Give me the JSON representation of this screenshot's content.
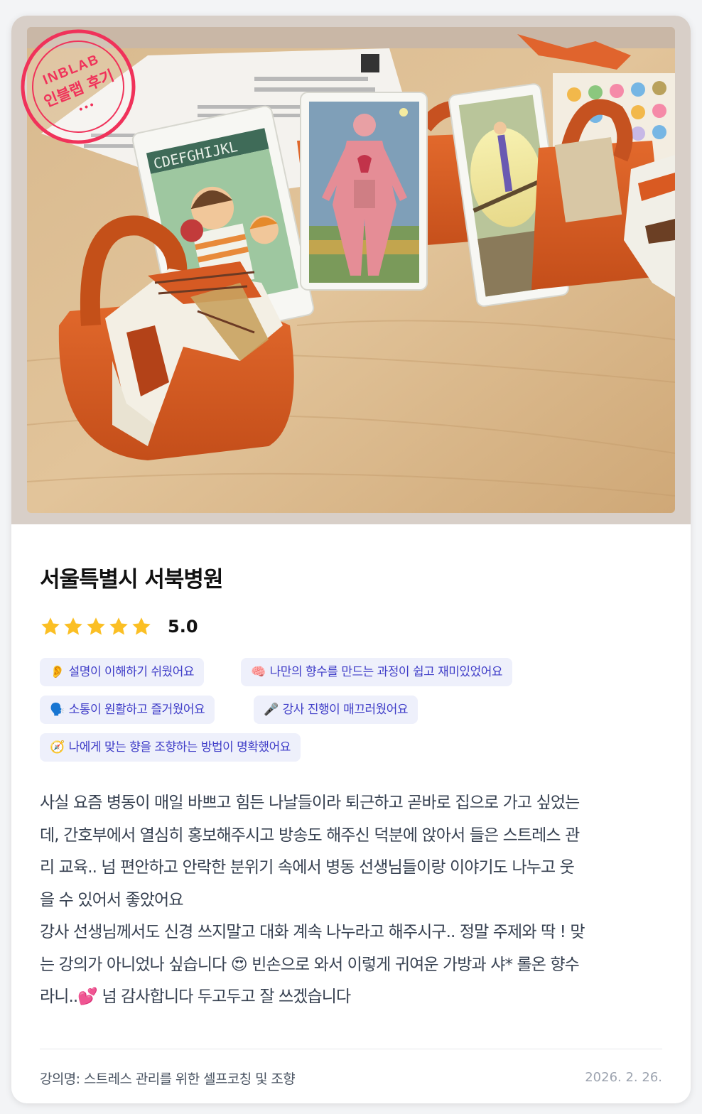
{
  "stamp": {
    "line1": "INBLAB",
    "line2": "인블랩 후기",
    "dots": "•••"
  },
  "review_card": {
    "title": "서울특별시 서북병원",
    "rating": {
      "stars": 5,
      "score": "5.0",
      "star_color": "#fbbf24"
    },
    "tags": [
      {
        "icon": "ear-icon",
        "emoji": "👂",
        "label": "설명이 이해하기 쉬웠어요"
      },
      {
        "icon": "brain-icon",
        "emoji": "🧠",
        "label": "나만의 향수를 만드는 과정이 쉽고 재미있었어요"
      },
      {
        "icon": "speaking-icon",
        "emoji": "🗣️",
        "label": "소통이 원활하고 즐거웠어요"
      },
      {
        "icon": "microphone-icon",
        "emoji": "🎤",
        "label": "강사 진행이 매끄러웠어요"
      },
      {
        "icon": "compass-icon",
        "emoji": "🧭",
        "label": "나에게 맞는 향을 조향하는 방법이 명확했어요"
      }
    ],
    "review_lines": [
      "사실 요즘 병동이 매일 바쁘고 힘든 나날들이라 퇴근하고 곧바로 집으로 가고 싶었는",
      "데, 간호부에서 열심히 홍보해주시고 방송도 해주신 덕분에 앉아서 들은 스트레스 관",
      "리 교육.. 넘 편안하고 안락한 분위기 속에서 병동 선생님들이랑 이야기도 나누고 웃",
      "을 수 있어서 좋았어요",
      "강사 선생님께서도 신경 쓰지말고 대화 계속 나누라고 해주시구.. 정말 주제와 딱 ! 맞",
      "는 강의가 아니었나 싶습니다 😍 빈손으로 와서 이렇게 귀여운 가방과 샤* 롤온 향수",
      "라니..💕 넘 감사합니다 두고두고 잘 쓰겠습니다"
    ],
    "course": "강의명: 스트레스 관리를 위한 셀프코칭 및 조향",
    "date": "2026. 2. 26.",
    "photo_card_text": "CDEFGHIJKL",
    "colors": {
      "tag_bg": "#eef0fb",
      "tag_text": "#3f3dc8",
      "stamp": "#f0325a",
      "bag": "#d95a22"
    }
  }
}
